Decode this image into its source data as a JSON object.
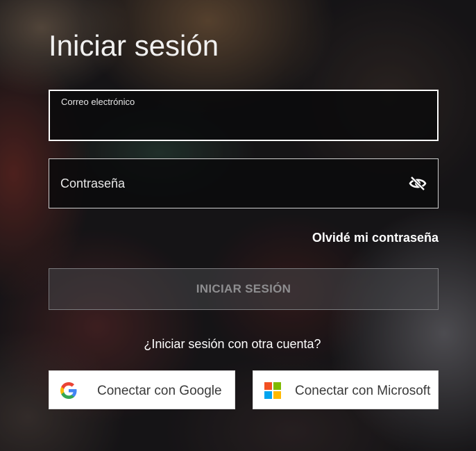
{
  "login": {
    "title": "Iniciar sesión",
    "email_label": "Correo electrónico",
    "email_value": "",
    "password_placeholder": "Contraseña",
    "password_toggle_icon": "eye-slash-icon",
    "forgot_password": "Olvidé mi contraseña",
    "submit_label": "INICIAR SESIÓN",
    "other_account_prompt": "¿Iniciar sesión con otra cuenta?",
    "google_label": "Conectar con Google",
    "microsoft_label": "Conectar con Microsoft"
  },
  "colors": {
    "microsoft_red": "#f25022",
    "microsoft_green": "#7fba00",
    "microsoft_blue": "#00a4ef",
    "microsoft_yellow": "#ffb900",
    "google_blue": "#4285f4",
    "google_red": "#ea4335",
    "google_yellow": "#fbbc05",
    "google_green": "#34a853"
  }
}
